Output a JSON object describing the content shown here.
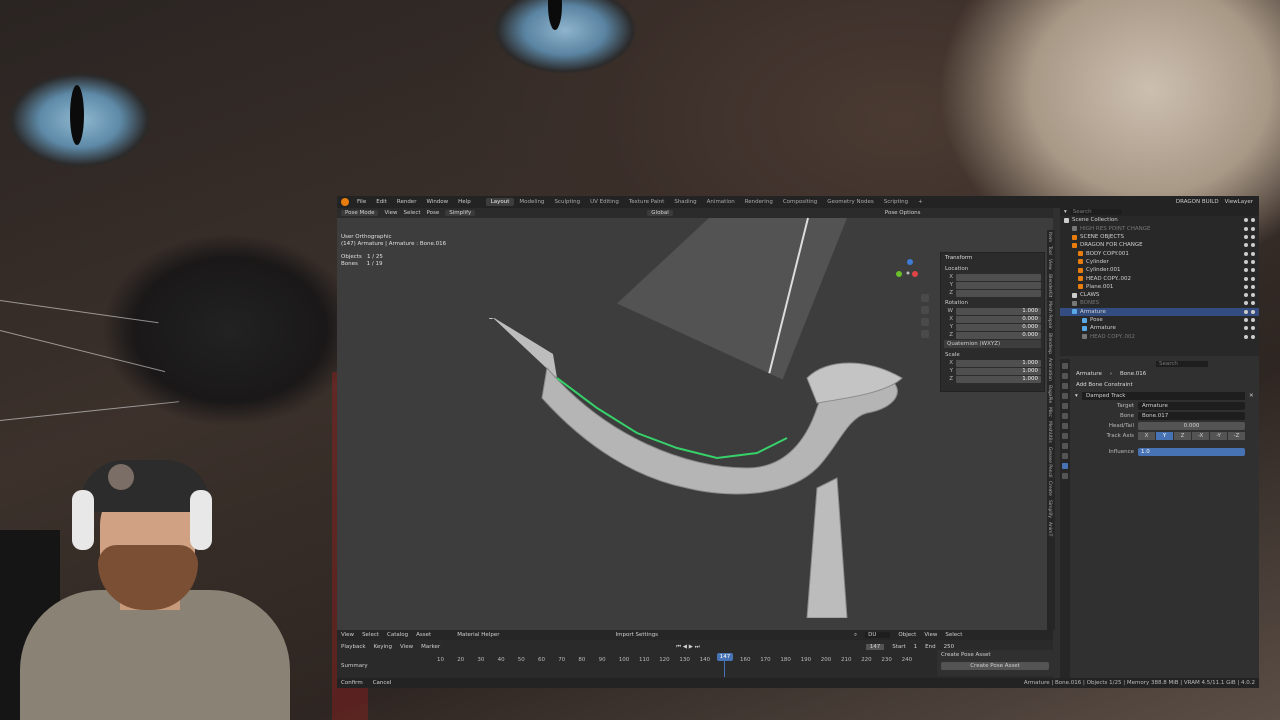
{
  "blender": {
    "menu": [
      "File",
      "Edit",
      "Render",
      "Window",
      "Help"
    ],
    "workspaces": [
      "Layout",
      "Modeling",
      "Sculpting",
      "UV Editing",
      "Texture Paint",
      "Shading",
      "Animation",
      "Rendering",
      "Compositing",
      "Geometry Nodes",
      "Scripting"
    ],
    "active_workspace": "Layout",
    "scene_name": "DRAGON BUILD",
    "view_layer": "ViewLayer",
    "header": {
      "mode": "Pose Mode",
      "view": "View",
      "select": "Select",
      "pose": "Pose",
      "simplify": "Simplify",
      "orientation": "Global",
      "pose_options": "Pose Options"
    },
    "viewport": {
      "view_name": "User Orthographic",
      "object_line": "(147) Armature | Armature : Bone.016",
      "objects_label": "Objects",
      "objects_value": "1 / 25",
      "bones_label": "Bones",
      "bones_value": "1 / 19"
    },
    "npanel": {
      "title": "Transform",
      "location": "Location",
      "rotation": "Rotation",
      "rotation_mode": "Quaternion (WXYZ)",
      "scale": "Scale",
      "rot_w": "1.000",
      "rot_x": "0.000",
      "rot_y": "0.000",
      "rot_z": "0.000",
      "scale_x": "1.000",
      "scale_y": "1.000",
      "scale_z": "1.000",
      "tabs": [
        "Item",
        "Tool",
        "View",
        "BlenderKit",
        "Mesh Repair",
        "Blendexp",
        "Animation",
        "BagaPie",
        "Misc",
        "MeshUtils",
        "Grease Pencil",
        "Create",
        "Simplify",
        "AnimT"
      ]
    },
    "timeline": {
      "playback": "Playback",
      "keying": "Keying",
      "view": "View",
      "marker": "Marker",
      "current_frame": "147",
      "start_label": "Start",
      "start": "1",
      "end_label": "End",
      "end": "250",
      "ticks": [
        "10",
        "20",
        "30",
        "40",
        "50",
        "60",
        "70",
        "80",
        "90",
        "100",
        "110",
        "120",
        "130",
        "140",
        "150",
        "160",
        "170",
        "180",
        "190",
        "200",
        "210",
        "220",
        "230",
        "240"
      ],
      "summary": "Summary",
      "create_pose_asset_title": "Create Pose Asset",
      "create_pose_asset_btn": "Create Pose Asset"
    },
    "asset_bar": {
      "view": "View",
      "select": "Select",
      "catalog": "Catalog",
      "asset": "Asset",
      "material_helper": "Material Helper",
      "import_settings": "Import Settings",
      "search": "DU",
      "object": "Object",
      "select2": "Select"
    },
    "statusbar": {
      "left1": "Confirm",
      "left2": "Cancel",
      "right": "Armature | Bone.016 | Objects 1/25 | Memory 388.8 MiB | VRAM 4.5/11.1 GiB | 4.0.2"
    },
    "outliner": {
      "search_placeholder": "Search",
      "items": [
        {
          "label": "Scene Collection",
          "color": "#cccccc",
          "dim": false,
          "sel": false
        },
        {
          "label": "HIGH RES POINT CHANGE",
          "color": "#777777",
          "dim": true,
          "sel": false
        },
        {
          "label": "SCENE OBJECTS",
          "color": "#e87d0d",
          "dim": false,
          "sel": false
        },
        {
          "label": "DRAGON FOR CHANGE",
          "color": "#e87d0d",
          "dim": false,
          "sel": false
        },
        {
          "label": "BODY COPY.001",
          "color": "#e87d0d",
          "dim": false,
          "sel": false
        },
        {
          "label": "Cylinder",
          "color": "#e87d0d",
          "dim": false,
          "sel": false
        },
        {
          "label": "Cylinder.001",
          "color": "#e87d0d",
          "dim": false,
          "sel": false
        },
        {
          "label": "HEAD COPY..002",
          "color": "#e87d0d",
          "dim": false,
          "sel": false
        },
        {
          "label": "Plane.001",
          "color": "#e87d0d",
          "dim": false,
          "sel": false
        },
        {
          "label": "CLAWS",
          "color": "#cccccc",
          "dim": false,
          "sel": false
        },
        {
          "label": "BONES",
          "color": "#777777",
          "dim": true,
          "sel": false
        },
        {
          "label": "Armature",
          "color": "#5aa9e6",
          "dim": false,
          "sel": true
        },
        {
          "label": "Pose",
          "color": "#5aa9e6",
          "dim": false,
          "sel": false
        },
        {
          "label": "Armature",
          "color": "#5aa9e6",
          "dim": false,
          "sel": false
        },
        {
          "label": "HEAD COPY..002",
          "color": "#777777",
          "dim": true,
          "sel": false
        }
      ]
    },
    "properties": {
      "search_placeholder": "Search",
      "breadcrumb_obj": "Armature",
      "breadcrumb_bone": "Bone.016",
      "add_constraint": "Add Bone Constraint",
      "constraint_name": "Damped Track",
      "target_label": "Target",
      "target_value": "Armature",
      "bone_label": "Bone",
      "bone_value": "Bone.017",
      "headtail_label": "Head/Tail",
      "headtail_value": "0.000",
      "trackaxis_label": "Track Axis",
      "axes": [
        "X",
        "Y",
        "Z",
        "-X",
        "-Y",
        "-Z"
      ],
      "active_axis": "Y",
      "influence_label": "Influence",
      "influence_value": "1.0"
    }
  },
  "colors": {
    "accent": "#4772b3",
    "blender_orange": "#e87d0d",
    "bone_green": "#37d16a"
  }
}
